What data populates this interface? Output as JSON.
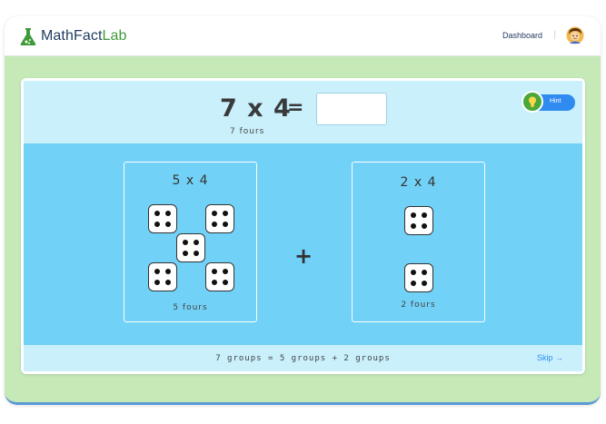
{
  "nav": {
    "logo_main": "MathFact",
    "logo_accent": "Lab",
    "dashboard_link": "Dashboard",
    "separator": "|",
    "logo_icon": "flask-icon",
    "avatar_icon": "student-avatar-icon"
  },
  "question": {
    "equation": "7 x 4",
    "equals": "=",
    "answer_value": "",
    "subtitle": "7 fours",
    "hint_label": "Hint",
    "hint_icon": "lightbulb-icon"
  },
  "groups": {
    "left": {
      "title": "5 x 4",
      "subtitle": "5 fours",
      "dice_count": 5,
      "pips_per_die": 4
    },
    "operator": "+",
    "right": {
      "title": "2 x 4",
      "subtitle": "2 fours",
      "dice_count": 2,
      "pips_per_die": 4
    }
  },
  "footer": {
    "equation_text": "7 groups = 5 groups + 2 groups",
    "skip_label": "Skip →"
  },
  "colors": {
    "background_green": "#c5eab8",
    "question_area": "#c9f0fb",
    "work_area": "#72d1f6",
    "hint_button": "#2f8bf0",
    "hint_icon": "#4aa83a",
    "logo_accent": "#3f9a3a",
    "nav_text": "#1f3a5f"
  }
}
